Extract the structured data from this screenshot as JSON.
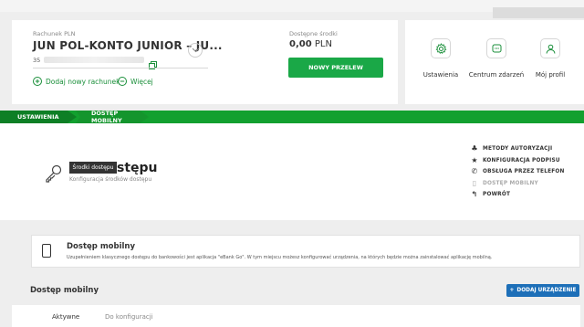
{
  "account": {
    "label": "Rachunek PLN",
    "name": "JUN POL-KONTO JUNIOR – JU...",
    "number_prefix": "35",
    "add_account": "Dodaj nowy rachunek",
    "more": "Więcej"
  },
  "balance": {
    "label": "Dostępne środki",
    "amount": "0,00",
    "currency": "PLN",
    "transfer_button": "NOWY PRZELEW"
  },
  "quick_links": [
    {
      "label": "Ustawienia",
      "icon": "gear-icon"
    },
    {
      "label": "Centrum zdarzeń",
      "icon": "message-icon"
    },
    {
      "label": "Mój profil",
      "icon": "user-icon"
    }
  ],
  "breadcrumb": {
    "items": [
      "USTAWIENIA",
      "DOSTĘP MOBILNY"
    ]
  },
  "header": {
    "tooltip": "Środki dostępu",
    "title_visible": "stępu",
    "subtitle": "Konfiguracja środków dostępu"
  },
  "actions": [
    {
      "label": "METODY AUTORYZACJI",
      "icon": "people-icon",
      "glyph": "♣"
    },
    {
      "label": "KONFIGURACJA PODPISU",
      "icon": "star-icon",
      "glyph": "★"
    },
    {
      "label": "OBSŁUGA PRZEZ TELEFON",
      "icon": "phone-icon",
      "glyph": "✆"
    },
    {
      "label": "DOSTĘP MOBILNY",
      "icon": "mobile-icon",
      "glyph": "▯"
    },
    {
      "label": "POWRÓT",
      "icon": "back-arrow-icon",
      "glyph": "↰"
    }
  ],
  "info": {
    "title": "Dostęp mobilny",
    "text": "Uzupełnieniem klasycznego dostępu do bankowości jest aplikacja \"eBank Go\". W tym miejscu możesz konfigurować urządzenia, na których będzie można zainstalować aplikację mobilną."
  },
  "section": {
    "title": "Dostęp mobilny",
    "add_button": "DODAJ URZĄDZENIE",
    "add_glyph": "+"
  },
  "tabs": {
    "active": "Aktywne",
    "other": "Do konfiguracji"
  },
  "colors": {
    "brand_green": "#1aa847",
    "dark_green": "#0e7f25",
    "accent_blue": "#1d6fb8"
  }
}
